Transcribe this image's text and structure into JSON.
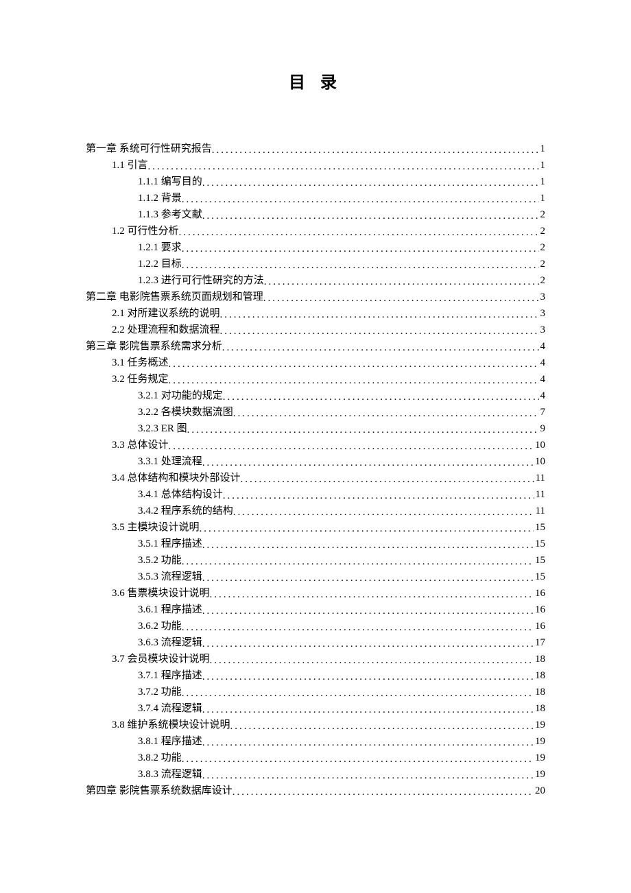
{
  "title": "目 录",
  "toc": [
    {
      "level": 0,
      "text": "第一章   系统可行性研究报告",
      "page": "1"
    },
    {
      "level": 1,
      "text": "1.1 引言",
      "page": "1"
    },
    {
      "level": 2,
      "text": "1.1.1 编写目的",
      "page": "1"
    },
    {
      "level": 2,
      "text": "1.1.2 背景",
      "page": "1"
    },
    {
      "level": 2,
      "text": "1.1.3 参考文献",
      "page": "2"
    },
    {
      "level": 1,
      "text": "1.2 可行性分析",
      "page": "2"
    },
    {
      "level": 2,
      "text": "1.2.1 要求",
      "page": "2"
    },
    {
      "level": 2,
      "text": "1.2.2 目标",
      "page": "2"
    },
    {
      "level": 2,
      "text": "1.2.3 进行可行性研究的方法",
      "page": "2"
    },
    {
      "level": 0,
      "text": "第二章   电影院售票系统页面规划和管理",
      "page": "3"
    },
    {
      "level": 1,
      "text": "2.1 对所建议系统的说明",
      "page": "3"
    },
    {
      "level": 1,
      "text": "2.2 处理流程和数据流程",
      "page": "3"
    },
    {
      "level": 0,
      "text": "第三章   影院售票系统需求分析",
      "page": "4"
    },
    {
      "level": 1,
      "text": "3.1 任务概述",
      "page": "4"
    },
    {
      "level": 1,
      "text": "3.2 任务规定",
      "page": "4"
    },
    {
      "level": 2,
      "text": "3.2.1 对功能的规定",
      "page": "4"
    },
    {
      "level": 2,
      "text": "3.2.2 各模块数据流图",
      "page": "7"
    },
    {
      "level": 2,
      "text": "3.2.3 ER 图",
      "page": "9"
    },
    {
      "level": 1,
      "text": "3.3 总体设计",
      "page": "10"
    },
    {
      "level": 2,
      "text": "3.3.1 处理流程",
      "page": "10"
    },
    {
      "level": 1,
      "text": "3.4 总体结构和模块外部设计",
      "page": "11"
    },
    {
      "level": 2,
      "text": "3.4.1 总体结构设计",
      "page": "11"
    },
    {
      "level": 2,
      "text": "3.4.2 程序系统的结构",
      "page": "11"
    },
    {
      "level": 1,
      "text": "3.5 主模块设计说明",
      "page": "15"
    },
    {
      "level": 2,
      "text": "3.5.1 程序描述",
      "page": "15"
    },
    {
      "level": 2,
      "text": "3.5.2 功能",
      "page": "15"
    },
    {
      "level": 2,
      "text": "3.5.3 流程逻辑",
      "page": "15"
    },
    {
      "level": 1,
      "text": "3.6 售票模块设计说明",
      "page": "16"
    },
    {
      "level": 2,
      "text": "3.6.1 程序描述",
      "page": "16"
    },
    {
      "level": 2,
      "text": "3.6.2 功能",
      "page": "16"
    },
    {
      "level": 2,
      "text": "3.6.3 流程逻辑",
      "page": "17"
    },
    {
      "level": 1,
      "text": "3.7 会员模块设计说明",
      "page": "18"
    },
    {
      "level": 2,
      "text": "3.7.1 程序描述",
      "page": "18"
    },
    {
      "level": 2,
      "text": "3.7.2 功能",
      "page": "18"
    },
    {
      "level": 2,
      "text": "3.7.4 流程逻辑",
      "page": "18"
    },
    {
      "level": 1,
      "text": "3.8 维护系统模块设计说明",
      "page": "19"
    },
    {
      "level": 2,
      "text": "3.8.1 程序描述",
      "page": "19"
    },
    {
      "level": 2,
      "text": "3.8.2 功能",
      "page": "19"
    },
    {
      "level": 2,
      "text": "3.8.3 流程逻辑",
      "page": "19"
    },
    {
      "level": 0,
      "text": "第四章   影院售票系统数据库设计",
      "page": "20"
    }
  ]
}
